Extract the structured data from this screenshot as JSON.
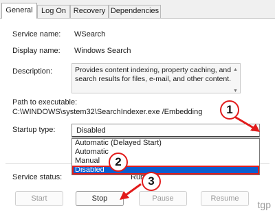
{
  "tabs": [
    {
      "label": "General",
      "active": true
    },
    {
      "label": "Log On"
    },
    {
      "label": "Recovery"
    },
    {
      "label": "Dependencies"
    }
  ],
  "fields": {
    "service_name_label": "Service name:",
    "service_name_value": "WSearch",
    "display_name_label": "Display name:",
    "display_name_value": "Windows Search",
    "description_label": "Description:",
    "description_value": "Provides content indexing, property caching, and search results for files, e-mail, and other content.",
    "path_label": "Path to executable:",
    "path_value": "C:\\WINDOWS\\system32\\SearchIndexer.exe /Embedding",
    "startup_type_label": "Startup type:",
    "startup_type_value": "Disabled"
  },
  "startup_options": [
    "Automatic (Delayed Start)",
    "Automatic",
    "Manual",
    "Disabled"
  ],
  "selected_option_index": 3,
  "service_status": {
    "label": "Service status:",
    "value": "Running"
  },
  "buttons": {
    "start": "Start",
    "stop": "Stop",
    "pause": "Pause",
    "resume": "Resume"
  },
  "annotations": [
    "1",
    "2",
    "3"
  ],
  "watermark": "tgp",
  "colors": {
    "highlight": "#0a5fd0",
    "annotation_red": "#e21b1b"
  }
}
